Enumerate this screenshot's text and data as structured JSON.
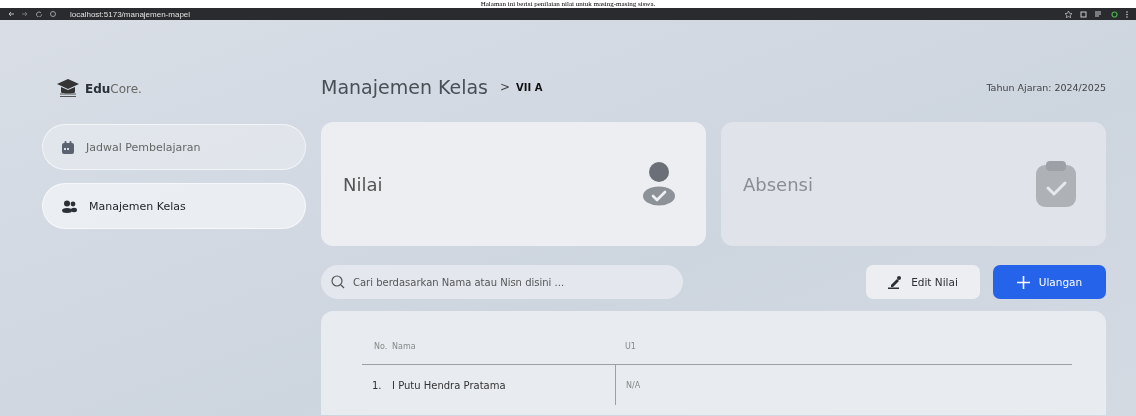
{
  "caption": "Halaman ini berisi penilaian nilai untuk masing-masing siswa.",
  "browser": {
    "url": "localhost:5173/manajemen-mapel"
  },
  "brand": {
    "bold": "Edu",
    "light": "Core."
  },
  "sidebar": {
    "items": [
      {
        "label": "Jadwal Pembelajaran",
        "selected": false
      },
      {
        "label": "Manajemen Kelas",
        "selected": true
      }
    ]
  },
  "header": {
    "title": "Manajemen Kelas",
    "separator": ">",
    "class": "VII A",
    "year": "Tahun Ajaran: 2024/2025"
  },
  "cards": [
    {
      "label": "Nilai",
      "selected": true
    },
    {
      "label": "Absensi",
      "selected": false
    }
  ],
  "search": {
    "placeholder": "Cari berdasarkan Nama atau Nisn disini ..."
  },
  "buttons": [
    {
      "label": "Edit Nilai",
      "kind": "secondary"
    },
    {
      "label": "Ulangan",
      "kind": "primary"
    }
  ],
  "table": {
    "columns": [
      "No.",
      "Nama",
      "U1"
    ],
    "rows": [
      [
        "1.",
        "I Putu Hendra Pratama",
        "N/A"
      ]
    ]
  }
}
